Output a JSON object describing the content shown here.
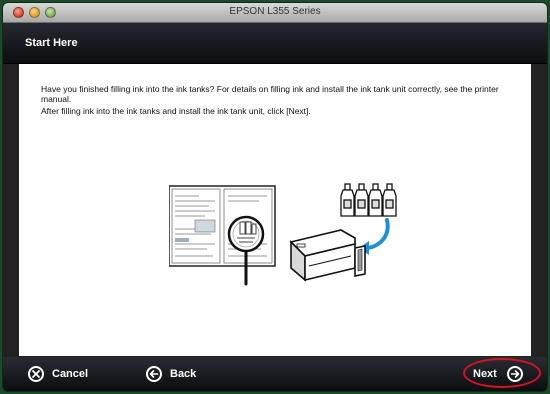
{
  "window": {
    "title": "EPSON L355 Series"
  },
  "header": {
    "title": "Start Here"
  },
  "content": {
    "line1": "Have you finished filling ink into the ink tanks? For details on filling ink and install the ink tank unit correctly, see the printer manual.",
    "line2": "After filling ink into the ink tanks and install the ink tank unit, click [Next]."
  },
  "footer": {
    "cancel_label": "Cancel",
    "back_label": "Back",
    "next_label": "Next"
  },
  "icons": {
    "cancel": "x-circle-icon",
    "back": "arrow-left-circle-icon",
    "next": "arrow-right-circle-icon"
  },
  "colors": {
    "highlight": "#d8131e",
    "accent_blue": "#1e8fd8"
  }
}
